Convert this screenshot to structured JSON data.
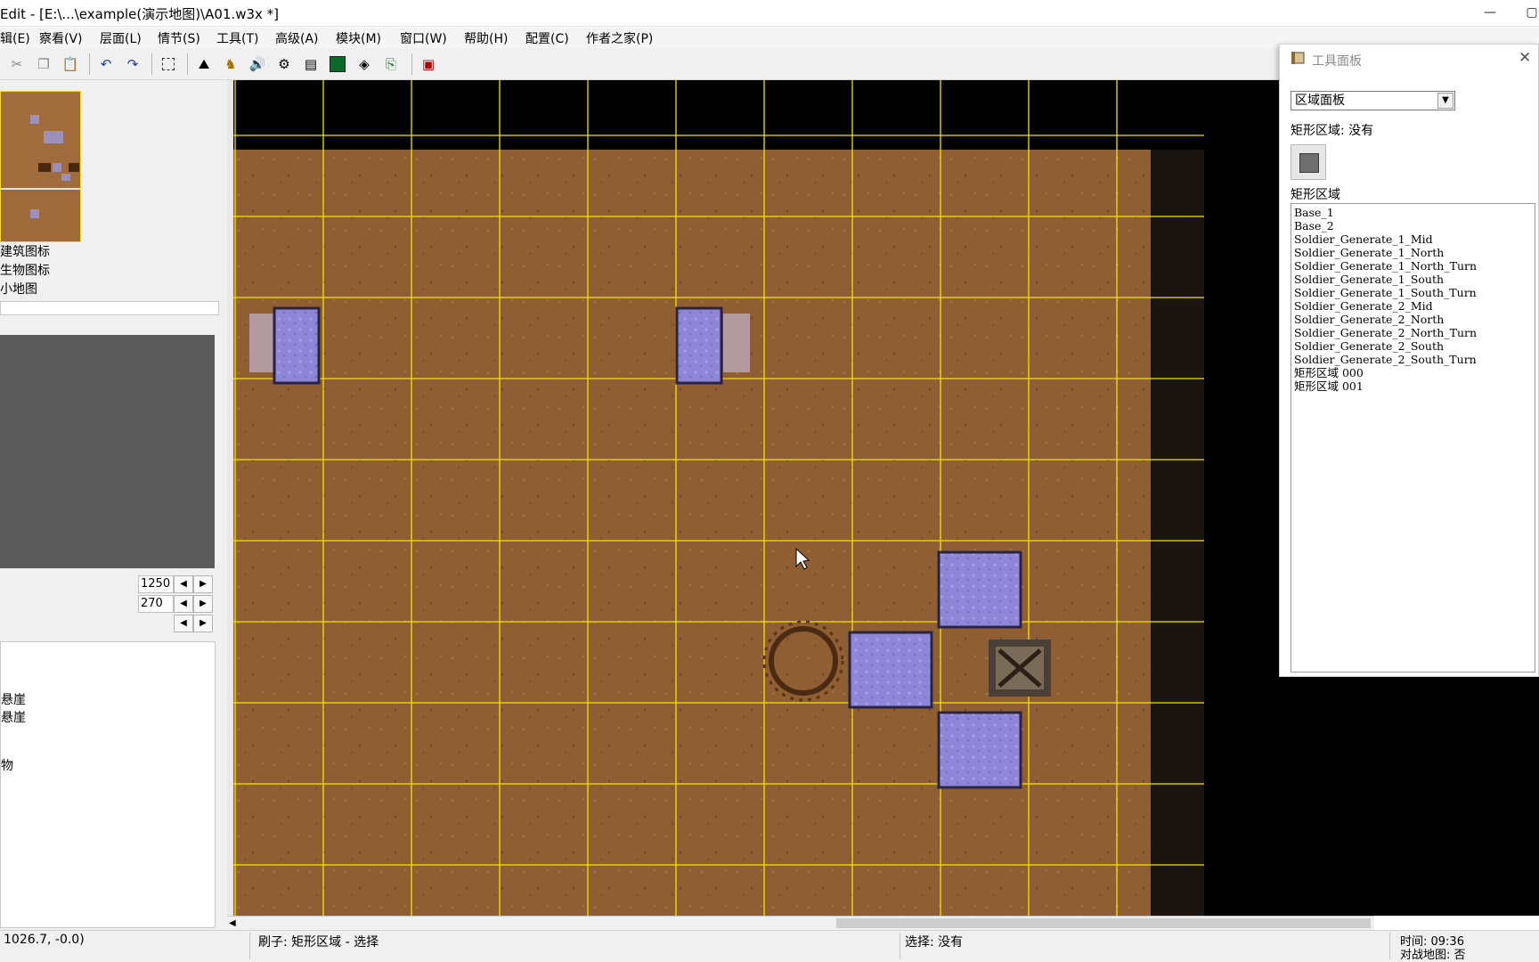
{
  "window": {
    "title": "Edit - [E:\\...\\example(演示地图)\\A01.w3x *]",
    "minimize": "—"
  },
  "menu": [
    "辑(E)",
    "察看(V)",
    "层面(L)",
    "情节(S)",
    "工具(T)",
    "高级(A)",
    "模块(M)",
    "窗口(W)",
    "帮助(H)",
    "配置(C)",
    "作者之家(P)"
  ],
  "toolbar": {
    "icons": [
      "cut-icon",
      "copy-icon",
      "paste-icon",
      "undo-icon",
      "redo-icon",
      "select-icon",
      "terrain-editor-icon",
      "unit-editor-icon",
      "sound-editor-icon",
      "object-editor-icon",
      "campaign-editor-icon",
      "trigger-editor-icon",
      "import-manager-icon",
      "object-manager-icon",
      "test-map-icon"
    ]
  },
  "left_panel": {
    "checks": [
      "建筑图标",
      "生物图标",
      "小地图"
    ],
    "spin": {
      "x": "1250",
      "y": "270"
    },
    "list_items": [
      "悬崖",
      "悬崖",
      "物"
    ]
  },
  "tool_panel": {
    "title": "工具面板",
    "close": "✕",
    "dropdown_value": "区域面板",
    "current_region_label": "矩形区域: 没有",
    "list_label": "矩形区域",
    "regions": [
      "Base_1",
      "Base_2",
      "Soldier_Generate_1_Mid",
      "Soldier_Generate_1_North",
      "Soldier_Generate_1_North_Turn",
      "Soldier_Generate_1_South",
      "Soldier_Generate_1_South_Turn",
      "Soldier_Generate_2_Mid",
      "Soldier_Generate_2_North",
      "Soldier_Generate_2_North_Turn",
      "Soldier_Generate_2_South",
      "Soldier_Generate_2_South_Turn",
      "矩形区域 000",
      "矩形区域 001"
    ]
  },
  "status": {
    "coords": "1026.7, -0.0)",
    "brush": "刷子: 矩形区域 - 选择",
    "selection": "选择: 没有",
    "time": "时间: 09:36",
    "melee": "对战地图: 否"
  },
  "colors": {
    "grid": "#f2e400",
    "dirt": "#8f5f33",
    "region_fill": "#8f86d8",
    "region_border": "#2a2440"
  }
}
